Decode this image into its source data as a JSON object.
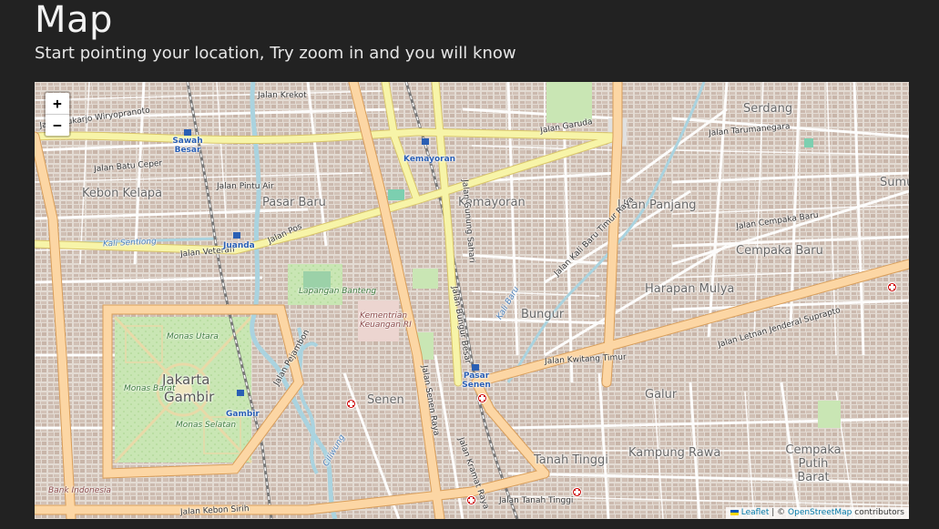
{
  "header": {
    "title": "Map",
    "subtitle": "Start pointing your location, Try zoom in and you will know"
  },
  "map": {
    "zoom_in_label": "+",
    "zoom_out_label": "−",
    "attribution": {
      "leaflet": "Leaflet",
      "separator": " | © ",
      "osm": "OpenStreetMap",
      "contributors": " contributors"
    },
    "labels": {
      "districts": [
        "Kebon Kelapa",
        "Pasar Baru",
        "Kemayoran",
        "Utan Panjang",
        "Serdang",
        "Cempaka Baru",
        "Harapan Mulya",
        "Bungur",
        "Senen",
        "Galur",
        "Kampung Rawa",
        "Tanah Tinggi",
        "Cempaka Putih Barat",
        "Sumur"
      ],
      "big": [
        "Jakarta",
        "Gambir"
      ],
      "roads": [
        "Jalan Garuda",
        "Jalan Letnan Jenderal Suprapto",
        "Jalan Veteran",
        "Jalan Pos",
        "Jalan Kebon Sirih",
        "Jalan Kwitang Timur",
        "Jalan Sukarjo Wiryopranoto",
        "Jalan Batu Ceper",
        "Jalan Krekot",
        "Jalan Pintu Air",
        "Jalan Kramat Raya",
        "Jalan Senen Raya",
        "Jalan Gunung Sahari",
        "Jalan Bungur Besar",
        "Jalan Pejambon",
        "Jalan Kali Baru Timur Raya",
        "Jalan Tanah Tinggi",
        "Jalan Cempaka Baru",
        "Jalan Tarumanegara"
      ],
      "parks": [
        "Lapangan Banteng",
        "Monas Utara",
        "Monas Barat",
        "Monas Selatan"
      ],
      "places": [
        "Kementrian Keuangan RI",
        "Bank Indonesia"
      ],
      "stations": [
        "Sawah Besar",
        "Kemayoran",
        "Juanda",
        "Gambir",
        "Pasar Senen"
      ],
      "water": [
        "Ciliwung",
        "Kali Sentiong",
        "Kali Baru"
      ]
    }
  }
}
